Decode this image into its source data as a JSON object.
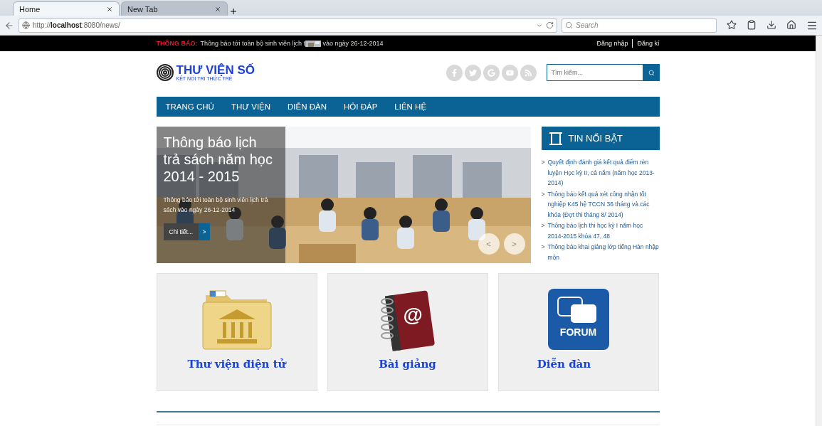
{
  "browser": {
    "tabs": [
      {
        "label": "Home",
        "selected": true
      },
      {
        "label": "New Tab",
        "selected": false
      }
    ],
    "url_prefix": "http://",
    "url_host": "localhost",
    "url_rest": ":8080/news/",
    "search_placeholder": "Search"
  },
  "notice": {
    "label": "THÔNG BÁO:",
    "text_before": "Thông báo tới toàn bộ sinh viên lịch t",
    "text_after": "vào ngày 26-12-2014",
    "links": [
      "Đăng nhập",
      "Đăng kí"
    ]
  },
  "header": {
    "logo_title": "THƯ VIỆN SỐ",
    "logo_tagline": "KẾT NỐI TRI THỨC TRẺ",
    "social": [
      {
        "kind": "facebook"
      },
      {
        "kind": "twitter"
      },
      {
        "kind": "google"
      },
      {
        "kind": "youtube"
      },
      {
        "kind": "rss"
      }
    ],
    "search_placeholder": "Tìm kiếm..."
  },
  "nav": [
    "TRANG CHỦ",
    "THƯ VIỆN",
    "DIỄN ĐÀN",
    "HỎI ĐÁP",
    "LIÊN HỆ"
  ],
  "slider": {
    "title": "Thông báo lịch trả sách năm học 2014 - 2015",
    "caption": "Thông báo tới toàn bộ sinh viên lịch trả sách vào ngày 26-12-2014",
    "button": "Chi tiết...",
    "button_arrow": ">",
    "prev": "<",
    "next": ">"
  },
  "featured": {
    "title": "TIN NỔI BẬT",
    "items": [
      "Quyết định đánh giá kết quả điểm rèn luyện Học kỳ II, cả năm (năm học 2013-2014)",
      "Thông báo kết quả xét công nhận tốt nghiệp K45 hệ TCCN 36 tháng và các khóa (Đợt thi tháng 8/ 2014)",
      "Thông báo lịch thi học kỳ I năm học 2014-2015 khóa 47, 48",
      "Thông báo khai giảng lớp tiếng Hàn nhập môn"
    ],
    "bullet": ">"
  },
  "tiles": [
    {
      "kind": "folder",
      "title": "Thư viện điện tử"
    },
    {
      "kind": "notebook",
      "title": "Bài giảng",
      "icon_text": "@"
    },
    {
      "kind": "forum",
      "title": "Diễn đàn",
      "icon_text": "FORUM"
    }
  ]
}
